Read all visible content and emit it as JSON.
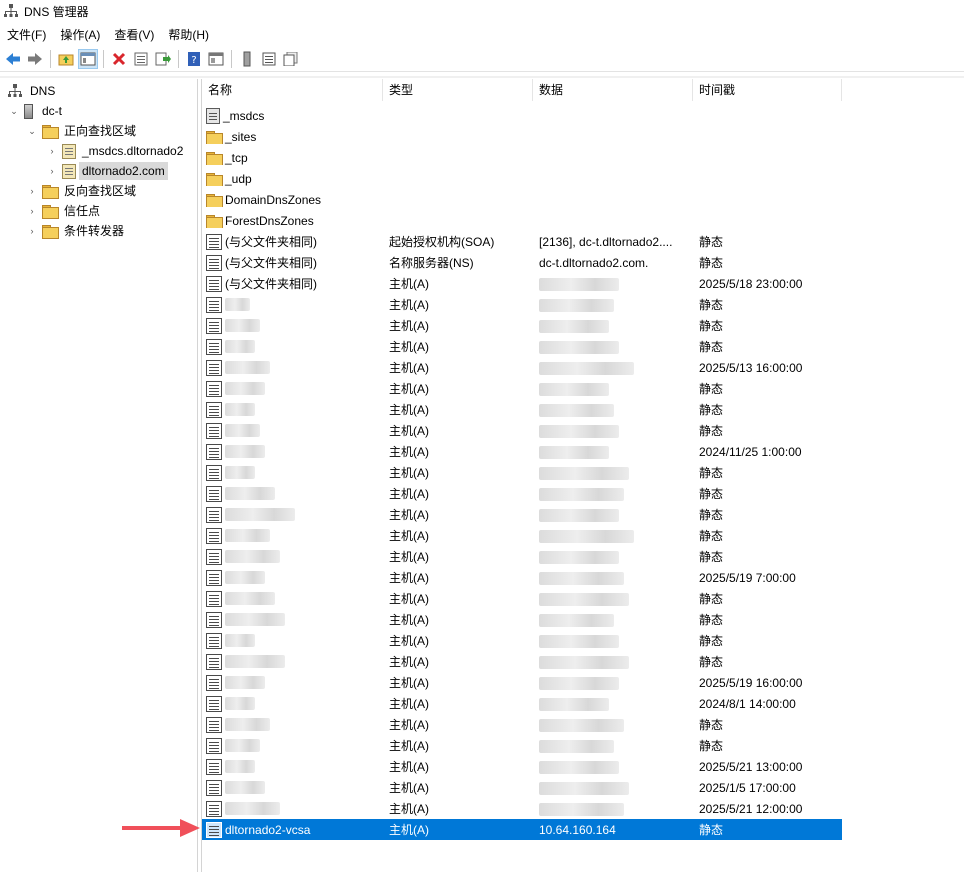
{
  "window": {
    "title": "DNS 管理器",
    "app_icon": "network-tree-icon"
  },
  "menu": [
    "文件(F)",
    "操作(A)",
    "查看(V)",
    "帮助(H)"
  ],
  "toolbar": {
    "buttons": [
      "back-arrow-icon",
      "forward-arrow-icon",
      "up-folder-icon",
      "show-hide-tree-icon",
      "delete-icon",
      "properties-icon",
      "export-list-icon",
      "help-icon",
      "details-view-icon",
      "server-icon",
      "record-icon",
      "multi-record-icon"
    ]
  },
  "tree": {
    "root": "DNS",
    "server": "dc-t",
    "forward_zones": "正向查找区域",
    "zone_msdcs": "_msdcs.dltornado2",
    "zone_main": "dltornado2.com",
    "reverse_zones": "反向查找区域",
    "trust_points": "信任点",
    "conditional_forwarders": "条件转发器"
  },
  "columns": {
    "name": "名称",
    "type": "类型",
    "data": "数据",
    "timestamp": "时间戳"
  },
  "records": [
    {
      "name": "_msdcs",
      "kind": "zone",
      "type": "",
      "data": "",
      "time": ""
    },
    {
      "name": "_sites",
      "kind": "folder",
      "type": "",
      "data": "",
      "time": ""
    },
    {
      "name": "_tcp",
      "kind": "folder",
      "type": "",
      "data": "",
      "time": ""
    },
    {
      "name": "_udp",
      "kind": "folder",
      "type": "",
      "data": "",
      "time": ""
    },
    {
      "name": "DomainDnsZones",
      "kind": "folder",
      "type": "",
      "data": "",
      "time": ""
    },
    {
      "name": "ForestDnsZones",
      "kind": "folder",
      "type": "",
      "data": "",
      "time": ""
    },
    {
      "name": "(与父文件夹相同)",
      "kind": "record",
      "type": "起始授权机构(SOA)",
      "data": "[2136], dc-t.dltornado2....",
      "time": "静态"
    },
    {
      "name": "(与父文件夹相同)",
      "kind": "record",
      "type": "名称服务器(NS)",
      "data": "dc-t.dltornado2.com.",
      "time": "静态"
    },
    {
      "name": "(与父文件夹相同)",
      "kind": "record",
      "type": "主机(A)",
      "data": "",
      "time": "2025/5/18 23:00:00"
    },
    {
      "name": "",
      "kind": "record",
      "type": "主机(A)",
      "data": "",
      "time": "静态"
    },
    {
      "name": "",
      "kind": "record",
      "type": "主机(A)",
      "data": "",
      "time": "静态"
    },
    {
      "name": "",
      "kind": "record",
      "type": "主机(A)",
      "data": "",
      "time": "静态"
    },
    {
      "name": "",
      "kind": "record",
      "type": "主机(A)",
      "data": "",
      "time": "2025/5/13 16:00:00"
    },
    {
      "name": "",
      "kind": "record",
      "type": "主机(A)",
      "data": "",
      "time": "静态"
    },
    {
      "name": "",
      "kind": "record",
      "type": "主机(A)",
      "data": "",
      "time": "静态"
    },
    {
      "name": "",
      "kind": "record",
      "type": "主机(A)",
      "data": "",
      "time": "静态"
    },
    {
      "name": "",
      "kind": "record",
      "type": "主机(A)",
      "data": "",
      "time": "2024/11/25 1:00:00"
    },
    {
      "name": "",
      "kind": "record",
      "type": "主机(A)",
      "data": "",
      "time": "静态"
    },
    {
      "name": "",
      "kind": "record",
      "type": "主机(A)",
      "data": "",
      "time": "静态"
    },
    {
      "name": "",
      "kind": "record",
      "type": "主机(A)",
      "data": "",
      "time": "静态"
    },
    {
      "name": "",
      "kind": "record",
      "type": "主机(A)",
      "data": "",
      "time": "静态"
    },
    {
      "name": "",
      "kind": "record",
      "type": "主机(A)",
      "data": "",
      "time": "静态"
    },
    {
      "name": "",
      "kind": "record",
      "type": "主机(A)",
      "data": "",
      "time": "2025/5/19 7:00:00"
    },
    {
      "name": "",
      "kind": "record",
      "type": "主机(A)",
      "data": "",
      "time": "静态"
    },
    {
      "name": "",
      "kind": "record",
      "type": "主机(A)",
      "data": "",
      "time": "静态"
    },
    {
      "name": "",
      "kind": "record",
      "type": "主机(A)",
      "data": "",
      "time": "静态"
    },
    {
      "name": "",
      "kind": "record",
      "type": "主机(A)",
      "data": "",
      "time": "静态"
    },
    {
      "name": "",
      "kind": "record",
      "type": "主机(A)",
      "data": "",
      "time": "2025/5/19 16:00:00"
    },
    {
      "name": "",
      "kind": "record",
      "type": "主机(A)",
      "data": "",
      "time": "2024/8/1 14:00:00"
    },
    {
      "name": "",
      "kind": "record",
      "type": "主机(A)",
      "data": "",
      "time": "静态"
    },
    {
      "name": "",
      "kind": "record",
      "type": "主机(A)",
      "data": "",
      "time": "静态"
    },
    {
      "name": "",
      "kind": "record",
      "type": "主机(A)",
      "data": "",
      "time": "2025/5/21 13:00:00"
    },
    {
      "name": "",
      "kind": "record",
      "type": "主机(A)",
      "data": "",
      "time": "2025/1/5 17:00:00"
    },
    {
      "name": "",
      "kind": "record",
      "type": "主机(A)",
      "data": "",
      "time": "2025/5/21 12:00:00"
    },
    {
      "name": "dltornado2-vcsa",
      "kind": "record",
      "type": "主机(A)",
      "data": "10.64.160.164",
      "time": "静态",
      "selected": true
    }
  ],
  "colors": {
    "selection": "#0078d7",
    "annotation_arrow": "#f0505a"
  }
}
